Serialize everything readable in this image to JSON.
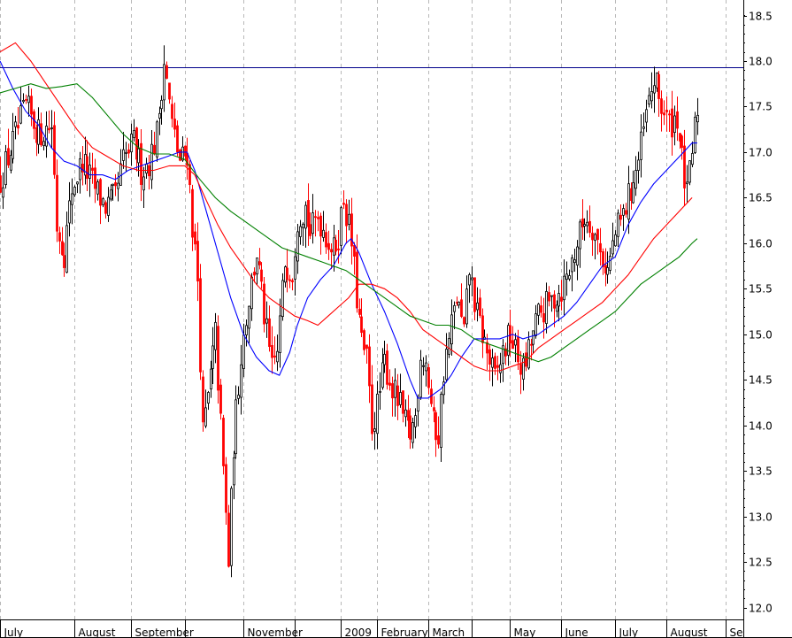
{
  "chart_data": {
    "type": "candlestick",
    "grid": true,
    "y_axis_side": "right",
    "ylim": [
      11.87,
      18.67
    ],
    "yticks": [
      {
        "value": 12.0,
        "label": "12.0"
      },
      {
        "value": 12.5,
        "label": "12.5"
      },
      {
        "value": 13.0,
        "label": "13.0"
      },
      {
        "value": 13.5,
        "label": "13.5"
      },
      {
        "value": 14.0,
        "label": "14.0"
      },
      {
        "value": 14.5,
        "label": "14.5"
      },
      {
        "value": 15.0,
        "label": "15.0"
      },
      {
        "value": 15.5,
        "label": "15.5"
      },
      {
        "value": 16.0,
        "label": "16.0"
      },
      {
        "value": 16.5,
        "label": "16.5"
      },
      {
        "value": 17.0,
        "label": "17.0"
      },
      {
        "value": 17.5,
        "label": "17.5"
      },
      {
        "value": 18.0,
        "label": "18.0"
      },
      {
        "value": 18.5,
        "label": "18.5"
      }
    ],
    "xlim": [
      0,
      290
    ],
    "x_periods": [
      {
        "label": "July",
        "start": 0
      },
      {
        "label": "August",
        "start": 29
      },
      {
        "label": "September",
        "start": 51
      },
      {
        "label": "",
        "start": 72
      },
      {
        "label": "November",
        "start": 95
      },
      {
        "label": "",
        "start": 115
      },
      {
        "label": "2009",
        "start": 133
      },
      {
        "label": "February",
        "start": 147
      },
      {
        "label": "March",
        "start": 167
      },
      {
        "label": "",
        "start": 184
      },
      {
        "label": "May",
        "start": 199
      },
      {
        "label": "June",
        "start": 219
      },
      {
        "label": "July",
        "start": 240
      },
      {
        "label": "August",
        "start": 260
      },
      {
        "label": "Se",
        "start": 283
      }
    ],
    "reference_line": {
      "value": 17.93,
      "color": "#00008b"
    },
    "candle_colors": {
      "up": "#000000",
      "down": "#ff0000"
    },
    "price_path": [
      [
        0,
        16.7
      ],
      [
        5,
        17.1
      ],
      [
        10,
        17.5
      ],
      [
        15,
        17.2
      ],
      [
        20,
        17.3
      ],
      [
        22,
        16.2
      ],
      [
        25,
        15.9
      ],
      [
        28,
        16.6
      ],
      [
        32,
        16.9
      ],
      [
        37,
        16.6
      ],
      [
        41,
        16.4
      ],
      [
        45,
        16.5
      ],
      [
        48,
        16.9
      ],
      [
        52,
        17.1
      ],
      [
        55,
        16.8
      ],
      [
        58,
        16.9
      ],
      [
        61,
        17.2
      ],
      [
        64,
        18.0
      ],
      [
        67,
        17.3
      ],
      [
        70,
        16.9
      ],
      [
        73,
        17.0
      ],
      [
        75,
        16.2
      ],
      [
        77,
        15.6
      ],
      [
        79,
        13.9
      ],
      [
        81,
        14.3
      ],
      [
        84,
        15.0
      ],
      [
        86,
        14.0
      ],
      [
        88,
        13.0
      ],
      [
        89,
        12.5
      ],
      [
        91,
        13.8
      ],
      [
        94,
        14.8
      ],
      [
        97,
        15.4
      ],
      [
        100,
        15.9
      ],
      [
        103,
        15.2
      ],
      [
        106,
        14.6
      ],
      [
        108,
        14.8
      ],
      [
        111,
        15.8
      ],
      [
        114,
        15.7
      ],
      [
        116,
        16.3
      ],
      [
        119,
        16.4
      ],
      [
        121,
        16.1
      ],
      [
        124,
        16.3
      ],
      [
        127,
        16.1
      ],
      [
        130,
        15.9
      ],
      [
        132,
        16.1
      ],
      [
        134,
        16.5
      ],
      [
        137,
        16.0
      ],
      [
        139,
        15.4
      ],
      [
        141,
        14.9
      ],
      [
        143,
        14.7
      ],
      [
        145,
        14.0
      ],
      [
        147,
        14.2
      ],
      [
        150,
        14.7
      ],
      [
        153,
        14.4
      ],
      [
        156,
        14.2
      ],
      [
        158,
        14.0
      ],
      [
        160,
        13.9
      ],
      [
        162,
        14.1
      ],
      [
        164,
        14.8
      ],
      [
        166,
        14.7
      ],
      [
        169,
        14.0
      ],
      [
        171,
        13.9
      ],
      [
        173,
        14.6
      ],
      [
        176,
        15.1
      ],
      [
        178,
        15.4
      ],
      [
        181,
        15.0
      ],
      [
        183,
        15.7
      ],
      [
        186,
        15.2
      ],
      [
        188,
        15.0
      ],
      [
        190,
        14.8
      ],
      [
        193,
        14.5
      ],
      [
        196,
        14.8
      ],
      [
        199,
        15.0
      ],
      [
        201,
        14.8
      ],
      [
        204,
        14.6
      ],
      [
        207,
        14.9
      ],
      [
        210,
        15.2
      ],
      [
        213,
        15.3
      ],
      [
        216,
        15.4
      ],
      [
        219,
        15.5
      ],
      [
        222,
        15.7
      ],
      [
        225,
        16.0
      ],
      [
        228,
        16.3
      ],
      [
        231,
        16.2
      ],
      [
        234,
        15.9
      ],
      [
        237,
        15.7
      ],
      [
        240,
        16.1
      ],
      [
        243,
        16.3
      ],
      [
        246,
        16.6
      ],
      [
        249,
        16.9
      ],
      [
        252,
        17.4
      ],
      [
        255,
        17.8
      ],
      [
        258,
        17.5
      ],
      [
        261,
        17.3
      ],
      [
        264,
        17.4
      ],
      [
        266,
        16.9
      ],
      [
        268,
        16.5
      ],
      [
        270,
        17.0
      ],
      [
        272,
        17.5
      ]
    ],
    "series": [
      {
        "color": "#0000ff",
        "points": [
          [
            0,
            18.0
          ],
          [
            5,
            17.7
          ],
          [
            10,
            17.45
          ],
          [
            15,
            17.3
          ],
          [
            20,
            17.05
          ],
          [
            25,
            16.9
          ],
          [
            30,
            16.85
          ],
          [
            35,
            16.75
          ],
          [
            40,
            16.75
          ],
          [
            45,
            16.7
          ],
          [
            50,
            16.8
          ],
          [
            55,
            16.85
          ],
          [
            60,
            16.9
          ],
          [
            65,
            16.95
          ],
          [
            70,
            17.0
          ],
          [
            73,
            17.0
          ],
          [
            76,
            16.8
          ],
          [
            80,
            16.4
          ],
          [
            85,
            15.9
          ],
          [
            90,
            15.4
          ],
          [
            95,
            15.0
          ],
          [
            100,
            14.75
          ],
          [
            105,
            14.6
          ],
          [
            109,
            14.55
          ],
          [
            113,
            14.8
          ],
          [
            116,
            15.1
          ],
          [
            120,
            15.4
          ],
          [
            125,
            15.6
          ],
          [
            130,
            15.75
          ],
          [
            135,
            16.0
          ],
          [
            137,
            16.05
          ],
          [
            140,
            15.9
          ],
          [
            145,
            15.55
          ],
          [
            150,
            15.25
          ],
          [
            155,
            14.9
          ],
          [
            160,
            14.5
          ],
          [
            163,
            14.3
          ],
          [
            167,
            14.3
          ],
          [
            172,
            14.4
          ],
          [
            176,
            14.55
          ],
          [
            180,
            14.75
          ],
          [
            185,
            14.95
          ],
          [
            190,
            14.95
          ],
          [
            195,
            14.95
          ],
          [
            200,
            15.0
          ],
          [
            204,
            14.95
          ],
          [
            210,
            15.0
          ],
          [
            215,
            15.1
          ],
          [
            220,
            15.2
          ],
          [
            225,
            15.35
          ],
          [
            230,
            15.55
          ],
          [
            235,
            15.75
          ],
          [
            240,
            15.85
          ],
          [
            245,
            16.2
          ],
          [
            250,
            16.45
          ],
          [
            255,
            16.65
          ],
          [
            260,
            16.8
          ],
          [
            265,
            16.95
          ],
          [
            270,
            17.1
          ],
          [
            272,
            17.1
          ]
        ]
      },
      {
        "color": "#ff0000",
        "points": [
          [
            0,
            18.1
          ],
          [
            6,
            18.2
          ],
          [
            12,
            18.0
          ],
          [
            18,
            17.75
          ],
          [
            24,
            17.5
          ],
          [
            30,
            17.25
          ],
          [
            36,
            17.05
          ],
          [
            42,
            16.95
          ],
          [
            48,
            16.85
          ],
          [
            54,
            16.8
          ],
          [
            60,
            16.8
          ],
          [
            66,
            16.85
          ],
          [
            72,
            16.85
          ],
          [
            76,
            16.75
          ],
          [
            80,
            16.5
          ],
          [
            85,
            16.2
          ],
          [
            90,
            15.95
          ],
          [
            95,
            15.75
          ],
          [
            100,
            15.55
          ],
          [
            105,
            15.4
          ],
          [
            110,
            15.3
          ],
          [
            115,
            15.2
          ],
          [
            120,
            15.15
          ],
          [
            124,
            15.1
          ],
          [
            128,
            15.2
          ],
          [
            132,
            15.3
          ],
          [
            136,
            15.4
          ],
          [
            140,
            15.55
          ],
          [
            145,
            15.55
          ],
          [
            150,
            15.5
          ],
          [
            155,
            15.4
          ],
          [
            160,
            15.25
          ],
          [
            165,
            15.05
          ],
          [
            170,
            14.95
          ],
          [
            175,
            14.85
          ],
          [
            180,
            14.75
          ],
          [
            185,
            14.65
          ],
          [
            190,
            14.6
          ],
          [
            195,
            14.6
          ],
          [
            200,
            14.65
          ],
          [
            205,
            14.7
          ],
          [
            210,
            14.85
          ],
          [
            215,
            14.95
          ],
          [
            220,
            15.05
          ],
          [
            225,
            15.15
          ],
          [
            230,
            15.25
          ],
          [
            235,
            15.35
          ],
          [
            240,
            15.5
          ],
          [
            245,
            15.65
          ],
          [
            250,
            15.85
          ],
          [
            255,
            16.05
          ],
          [
            260,
            16.2
          ],
          [
            265,
            16.35
          ],
          [
            270,
            16.5
          ]
        ]
      },
      {
        "color": "#008000",
        "points": [
          [
            0,
            17.65
          ],
          [
            6,
            17.7
          ],
          [
            12,
            17.75
          ],
          [
            18,
            17.7
          ],
          [
            24,
            17.72
          ],
          [
            30,
            17.75
          ],
          [
            36,
            17.6
          ],
          [
            42,
            17.4
          ],
          [
            48,
            17.2
          ],
          [
            54,
            17.05
          ],
          [
            60,
            16.98
          ],
          [
            66,
            16.98
          ],
          [
            72,
            16.92
          ],
          [
            78,
            16.7
          ],
          [
            84,
            16.5
          ],
          [
            90,
            16.35
          ],
          [
            95,
            16.25
          ],
          [
            100,
            16.15
          ],
          [
            105,
            16.05
          ],
          [
            110,
            15.95
          ],
          [
            115,
            15.9
          ],
          [
            120,
            15.85
          ],
          [
            125,
            15.8
          ],
          [
            130,
            15.75
          ],
          [
            135,
            15.7
          ],
          [
            140,
            15.6
          ],
          [
            145,
            15.5
          ],
          [
            150,
            15.4
          ],
          [
            155,
            15.3
          ],
          [
            160,
            15.2
          ],
          [
            165,
            15.15
          ],
          [
            170,
            15.1
          ],
          [
            175,
            15.1
          ],
          [
            180,
            15.05
          ],
          [
            185,
            14.95
          ],
          [
            190,
            14.9
          ],
          [
            195,
            14.85
          ],
          [
            200,
            14.8
          ],
          [
            205,
            14.75
          ],
          [
            210,
            14.7
          ],
          [
            215,
            14.75
          ],
          [
            220,
            14.85
          ],
          [
            225,
            14.95
          ],
          [
            230,
            15.05
          ],
          [
            235,
            15.15
          ],
          [
            240,
            15.25
          ],
          [
            245,
            15.4
          ],
          [
            250,
            15.55
          ],
          [
            255,
            15.65
          ],
          [
            260,
            15.75
          ],
          [
            265,
            15.85
          ],
          [
            270,
            16.0
          ],
          [
            272,
            16.05
          ]
        ]
      }
    ]
  }
}
